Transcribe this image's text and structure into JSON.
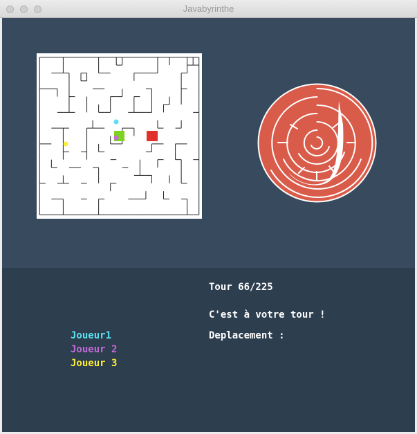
{
  "window": {
    "title": "Javabyrinthe"
  },
  "board": {
    "rows": [
      "############################",
      "#   #     #  ##     # #  ###",
      "# #### ## ###   #####   ## #",
      "#    # ##    #  #       #  #",
      "#### #   ###  #   ## #  ## #",
      "#  # ## #   ### ## #  # #  #",
      "# #  #  # # #   #  # ## #  #",
      "#  #### # ###  ##### #    ##",
      "#        #          #   #  #",
      "# ####  ####  ###   ## ##  #",
      "#   # # #   # # # #   #    #",
      "### #   # # ###    ### ### #",
      "#   ## ## ##   #  ##   #   #",
      "# # #   #   ##   #  ## ## ##",
      "# ## ### ##   ## #  #   #  #",
      "#   #     #     ####  # #  #",
      "## ### ## # ## #   #  # ## #",
      "#     #  #  #     #  #     #",
      "# ###  ## ## # ####  ## ## #",
      "#   #     #              # #",
      "############################"
    ],
    "colors": {
      "wall": "#222222",
      "floor": "#ffffff",
      "green_tile": "#7ed321",
      "red_tile": "#e0312b",
      "player1": "#5ce1f0",
      "player2": "#c46ad9",
      "player3": "#ffee33"
    }
  },
  "logo": {
    "colors": {
      "disc": "#d95c4a",
      "line": "#ffffff"
    }
  },
  "status": {
    "turn": "Tour 66/225",
    "message": "C'est à votre tour !",
    "move_label": "Deplacement :"
  },
  "players": [
    {
      "name": "Joueur1",
      "color": "#5ce1f0"
    },
    {
      "name": "Joueur 2",
      "color": "#c46ad9"
    },
    {
      "name": "Joueur 3",
      "color": "#ffee33"
    }
  ]
}
